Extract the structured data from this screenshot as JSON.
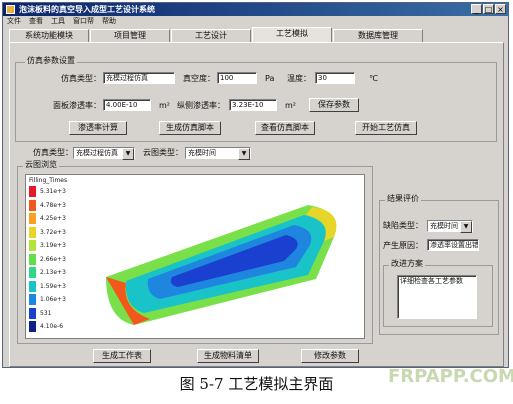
{
  "window": {
    "title": "泡沫板料的真空导入成型工艺设计系统"
  },
  "menu": [
    "文件",
    "查看",
    "工具",
    "窗口帮",
    "帮助"
  ],
  "tabs": [
    {
      "label": "系统功能模块"
    },
    {
      "label": "项目管理"
    },
    {
      "label": "工艺设计"
    },
    {
      "label": "工艺模拟"
    },
    {
      "label": "数据库管理"
    }
  ],
  "sim_params": {
    "group_label": "仿真参数设置",
    "type_label": "仿真类型：",
    "type_value": "充模过程仿真",
    "vacuum_label": "真空度：",
    "vacuum_value": "100",
    "vacuum_unit": "Pa",
    "temp_label": "温度：",
    "temp_value": "30",
    "temp_unit": "℃",
    "face_perm_label": "面板渗透率：",
    "face_perm_value": "4.00E-10",
    "face_perm_unit": "m²",
    "side_perm_label": "纵侧渗透率：",
    "side_perm_value": "3.23E-10",
    "side_perm_unit": "m²",
    "save_params": "保存参数",
    "calc_perm": "渗透率计算",
    "gen_script": "生成仿真脚本",
    "view_script": "查看仿真脚本",
    "start_sim": "开始工艺仿真"
  },
  "selectors": {
    "sim_type_label": "仿真类型：",
    "sim_type_value": "充模过程仿真",
    "cloud_type_label": "云图类型：",
    "cloud_type_value": "充模时间"
  },
  "cloud_view": {
    "group_label": "云图浏览",
    "legend_title": "Filling_Times",
    "legend": [
      {
        "value": "5.31e+3",
        "color": "#e8182a"
      },
      {
        "value": "4.78e+3",
        "color": "#f2571c"
      },
      {
        "value": "4.25e+3",
        "color": "#f5a21e"
      },
      {
        "value": "3.72e+3",
        "color": "#e8d52a"
      },
      {
        "value": "3.19e+3",
        "color": "#b4e43a"
      },
      {
        "value": "2.66e+3",
        "color": "#5fe04a"
      },
      {
        "value": "2.13e+3",
        "color": "#2dd88a"
      },
      {
        "value": "1.59e+3",
        "color": "#1ac3c8"
      },
      {
        "value": "1.06e+3",
        "color": "#1f86e0"
      },
      {
        "value": "531",
        "color": "#1a40d0"
      },
      {
        "value": "4.10e-6",
        "color": "#10208a"
      }
    ]
  },
  "results": {
    "group_label": "结果评价",
    "defect_type_label": "缺陷类型：",
    "defect_type_value": "充模时间",
    "cause_label": "产生原因：",
    "cause_value": "渗透率设置出错",
    "improve_label": "改进方案",
    "improve_text": "详细检查各工艺参数"
  },
  "bottom_buttons": {
    "gen_process_sheet": "生成工作表",
    "gen_material_list": "生成物料清单",
    "modify_params": "修改参数"
  },
  "caption": "图 5-7 工艺模拟主界面",
  "watermark": "FRPAPP.COM"
}
